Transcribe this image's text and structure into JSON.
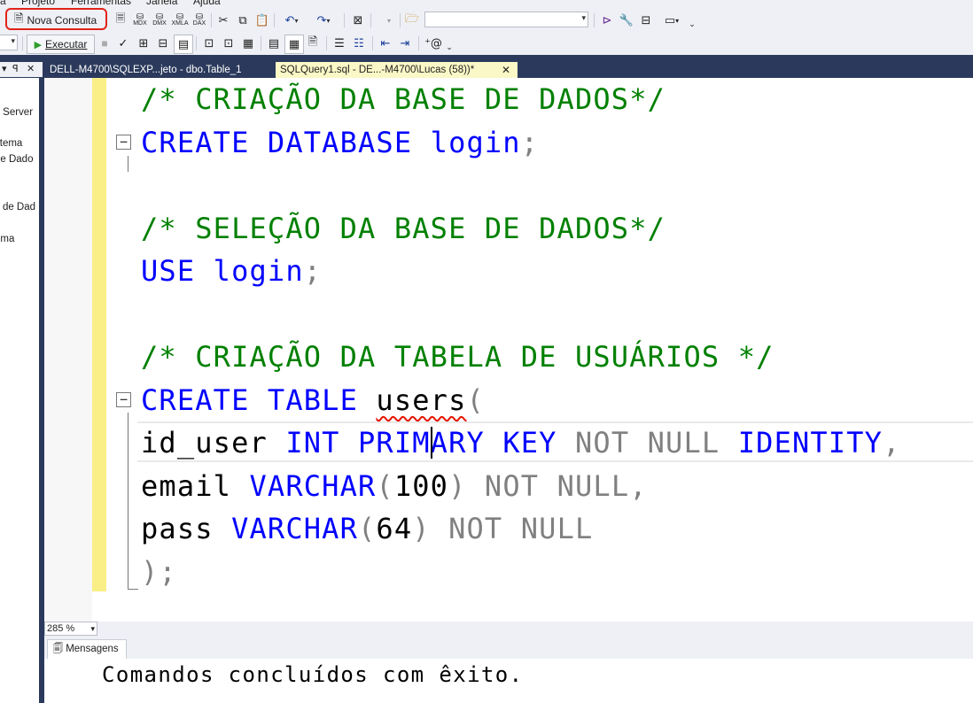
{
  "menu": {
    "items": [
      "a",
      "Projeto",
      "Ferramentas",
      "Janela",
      "Ajuda"
    ]
  },
  "toolbar": {
    "new_query_label": "Nova Consulta",
    "execute_label": "Executar",
    "mdx_label": "MDX",
    "dmx_label": "DMX",
    "xmla_label": "XMLA",
    "dax_label": "DAX",
    "database_combo_value": ""
  },
  "tabs": [
    {
      "label": "DELL-M4700\\SQLEXP...jeto - dbo.Table_1",
      "active": false
    },
    {
      "label": "SQLQuery1.sql - DE...-M4700\\Lucas (58))*",
      "active": true,
      "close": "✕"
    }
  ],
  "left_panel": {
    "tab_controls": [
      "▾",
      "ꟼ",
      "✕"
    ],
    "items": [
      "L Server",
      "stema",
      "de Dado",
      "s de Dad",
      "ema"
    ]
  },
  "editor": {
    "lines": [
      [
        {
          "t": "/* CRIAÇÃO DA BASE DE DADOS*/",
          "c": "cmt"
        }
      ],
      [
        {
          "t": "CREATE DATABASE",
          "c": "kw"
        },
        {
          "t": " login",
          "c": "kw"
        },
        {
          "t": ";",
          "c": "gr"
        }
      ],
      [],
      [
        {
          "t": "/* SELEÇÃO DA BASE DE DADOS*/",
          "c": "cmt"
        }
      ],
      [
        {
          "t": "USE",
          "c": "kw"
        },
        {
          "t": " login",
          "c": "kw"
        },
        {
          "t": ";",
          "c": "gr"
        }
      ],
      [],
      [
        {
          "t": "/* CRIAÇÃO DA TABELA DE USUÁRIOS */",
          "c": "cmt"
        }
      ],
      [
        {
          "t": "CREATE TABLE ",
          "c": "kw"
        },
        {
          "t": "users",
          "c": "tx",
          "squiggle": true
        },
        {
          "t": "(",
          "c": "gr"
        }
      ],
      [
        {
          "t": "id_user ",
          "c": "tx"
        },
        {
          "t": "INT PRIMARY KEY ",
          "c": "kw"
        },
        {
          "t": "NOT NULL ",
          "c": "gr"
        },
        {
          "t": "IDENTITY",
          "c": "kw"
        },
        {
          "t": ",",
          "c": "gr"
        }
      ],
      [
        {
          "t": "email ",
          "c": "tx"
        },
        {
          "t": "VARCHAR",
          "c": "kw"
        },
        {
          "t": "(",
          "c": "gr"
        },
        {
          "t": "100",
          "c": "tx"
        },
        {
          "t": ") NOT NULL,",
          "c": "gr"
        }
      ],
      [
        {
          "t": "pass ",
          "c": "tx"
        },
        {
          "t": "VARCHAR",
          "c": "kw"
        },
        {
          "t": "(",
          "c": "gr"
        },
        {
          "t": "64",
          "c": "tx"
        },
        {
          "t": ") NOT NULL",
          "c": "gr"
        }
      ],
      [
        {
          "t": ");",
          "c": "gr"
        }
      ]
    ],
    "fold_glyph": "−"
  },
  "zoom": {
    "value": "285 %"
  },
  "messages": {
    "tab_label": "Mensagens",
    "text": "Comandos concluídos com êxito."
  },
  "colors": {
    "comment": "#008000",
    "keyword": "#0000ff",
    "operator": "#808080",
    "accent": "#2b3a5c",
    "highlight": "#e2231a"
  }
}
